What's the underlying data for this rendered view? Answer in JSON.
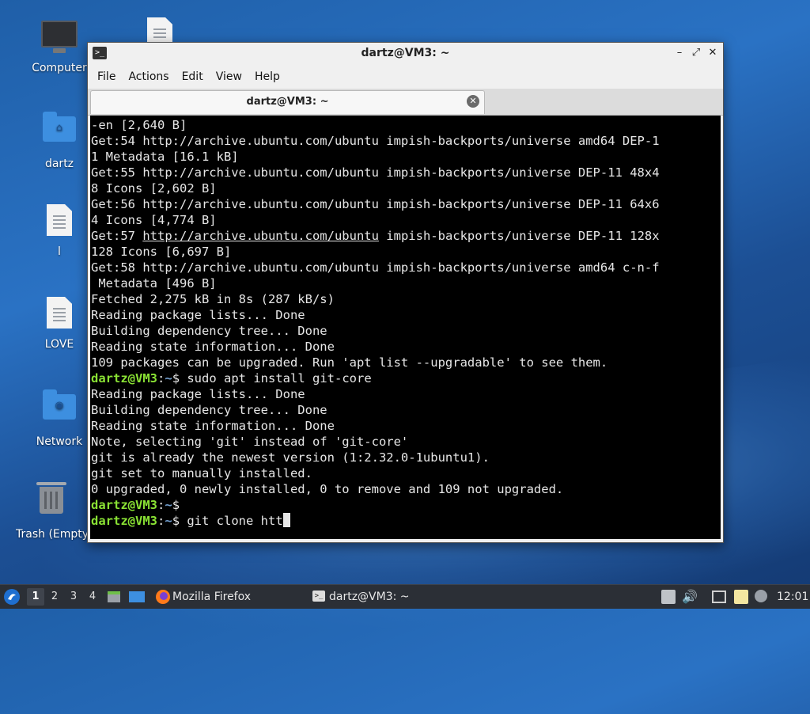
{
  "desktop": {
    "icons": [
      {
        "label": "Computer",
        "icon": "computer-icon"
      },
      {
        "label": "dartz",
        "icon": "home-folder-icon"
      },
      {
        "label": "l",
        "icon": "document-icon"
      },
      {
        "label": "LOVE",
        "icon": "document-icon"
      },
      {
        "label": "Network",
        "icon": "network-folder-icon"
      },
      {
        "label": "Trash (Empty)",
        "icon": "trash-icon"
      }
    ]
  },
  "window": {
    "title": "dartz@VM3: ~",
    "menu": [
      "File",
      "Actions",
      "Edit",
      "View",
      "Help"
    ],
    "tab_label": "dartz@VM3: ~",
    "prompt_user": "dartz@VM3",
    "prompt_path": "~",
    "lines": [
      "-en [2,640 B]",
      "Get:54 http://archive.ubuntu.com/ubuntu impish-backports/universe amd64 DEP-1",
      "1 Metadata [16.1 kB]",
      "Get:55 http://archive.ubuntu.com/ubuntu impish-backports/universe DEP-11 48x4",
      "8 Icons [2,602 B]",
      "Get:56 http://archive.ubuntu.com/ubuntu impish-backports/universe DEP-11 64x6",
      "4 Icons [4,774 B]",
      "Get:57 ",
      "http://archive.ubuntu.com/ubuntu",
      " impish-backports/universe DEP-11 128x",
      "128 Icons [6,697 B]",
      "Get:58 http://archive.ubuntu.com/ubuntu impish-backports/universe amd64 c-n-f",
      " Metadata [496 B]",
      "Fetched 2,275 kB in 8s (287 kB/s)",
      "Reading package lists... Done",
      "Building dependency tree... Done",
      "Reading state information... Done",
      "109 packages can be upgraded. Run 'apt list --upgradable' to see them.",
      "$ sudo apt install git-core",
      "Reading package lists... Done",
      "Building dependency tree... Done",
      "Reading state information... Done",
      "Note, selecting 'git' instead of 'git-core'",
      "git is already the newest version (1:2.32.0-1ubuntu1).",
      "git set to manually installed.",
      "0 upgraded, 0 newly installed, 0 to remove and 109 not upgraded.",
      "$",
      "$ git clone htt"
    ]
  },
  "taskbar": {
    "workspaces": [
      "1",
      "2",
      "3",
      "4"
    ],
    "firefox_label": "Mozilla Firefox",
    "terminal_label": "dartz@VM3: ~",
    "clock": "12:01"
  }
}
